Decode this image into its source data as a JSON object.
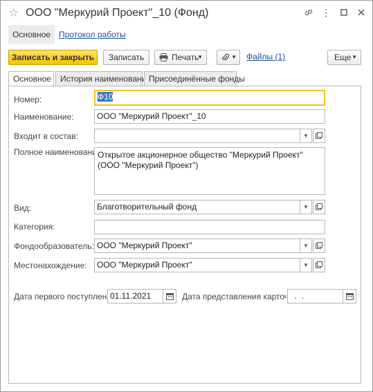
{
  "window": {
    "title": "ООО \"Меркурий Проект\"_10 (Фонд)"
  },
  "nav": {
    "main_tab": "Основное",
    "log_link": "Протокол работы"
  },
  "toolbar": {
    "save_close_label": "Записать и закрыть",
    "save_label": "Записать",
    "print_label": "Печать",
    "files_label": "Файлы (1)",
    "more_label": "Еще"
  },
  "tabs": [
    {
      "label": "Основное"
    },
    {
      "label": "История наименований"
    },
    {
      "label": "Присоединённые фонды"
    }
  ],
  "form": {
    "number": {
      "label": "Номер:",
      "value": "Ф10"
    },
    "name": {
      "label": "Наименование:",
      "value": "ООО \"Меркурий Проект\"_10"
    },
    "parent": {
      "label": "Входит в состав:",
      "value": ""
    },
    "full_name": {
      "label": "Полное наименование:",
      "value": "Открытое акционерное общество \"Меркурий Проект\" (ООО \"Меркурий Проект\")"
    },
    "kind": {
      "label": "Вид:",
      "value": "Благотворительный фонд"
    },
    "category": {
      "label": "Категория:",
      "value": ""
    },
    "founder": {
      "label": "Фондообразователь:",
      "value": "ООО \"Меркурий Проект\""
    },
    "location": {
      "label": "Местонахождение:",
      "value": "ООО \"Меркурий Проект\""
    },
    "first_receipt": {
      "label": "Дата первого поступления:",
      "value": "01.11.2021"
    },
    "card_date": {
      "label": "Дата представления карточки:",
      "value": "  .  ."
    }
  },
  "icons": {
    "star": "star-icon",
    "link": "link-icon",
    "menu": "more-vert-icon",
    "maximize": "maximize-icon",
    "close": "close-icon",
    "printer": "printer-icon",
    "paperclip": "paperclip-icon",
    "calendar": "calendar-icon",
    "open": "open-form-icon",
    "dropdown": "dropdown-arrow-icon"
  },
  "colors": {
    "primary_button": "#f5c400",
    "link": "#1f4c9c",
    "focus_border": "#f0c020",
    "selection": "#3a76c4"
  }
}
